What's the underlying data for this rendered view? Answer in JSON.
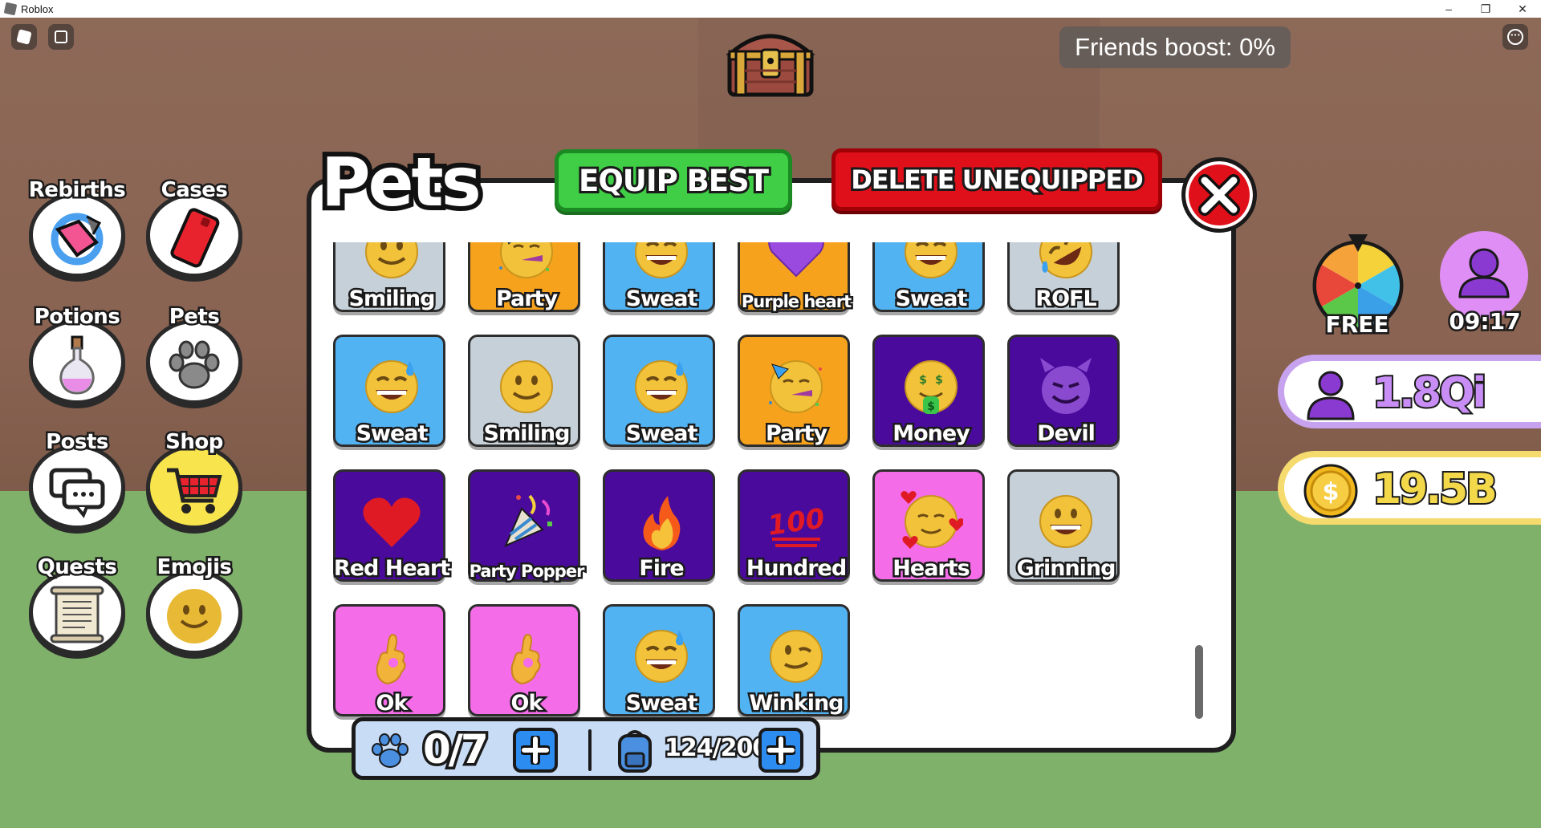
{
  "window": {
    "title": "Roblox",
    "controls": {
      "minimize": "–",
      "maximize": "❐",
      "close": "✕"
    }
  },
  "hud": {
    "friends_boost": "Friends boost: 0%",
    "spin_label": "FREE",
    "timer_label": "09:17",
    "followers_value": "1.8Qi",
    "coins_value": "19.5B"
  },
  "menu": [
    {
      "label": "Rebirths",
      "icon": "rebirth-icon"
    },
    {
      "label": "Cases",
      "icon": "phone-case-icon"
    },
    {
      "label": "Potions",
      "icon": "potion-icon"
    },
    {
      "label": "Pets",
      "icon": "paw-icon"
    },
    {
      "label": "Posts",
      "icon": "chat-icon"
    },
    {
      "label": "Shop",
      "icon": "cart-icon"
    },
    {
      "label": "Quests",
      "icon": "scroll-icon"
    },
    {
      "label": "Emojis",
      "icon": "smiley-icon"
    }
  ],
  "panel": {
    "title": "Pets",
    "equip_best": "EQUIP BEST",
    "delete_unequipped": "DELETE UNEQUIPPED",
    "pets": [
      {
        "name": "Smiling",
        "color": "gray",
        "emoji": "smiling"
      },
      {
        "name": "Party",
        "color": "orange",
        "emoji": "party"
      },
      {
        "name": "Sweat",
        "color": "blue",
        "emoji": "sweat"
      },
      {
        "name": "Purple heart",
        "color": "orange",
        "emoji": "purple-heart"
      },
      {
        "name": "Sweat",
        "color": "blue",
        "emoji": "sweat"
      },
      {
        "name": "ROFL",
        "color": "gray",
        "emoji": "rofl"
      },
      {
        "name": "Sweat",
        "color": "blue",
        "emoji": "sweat"
      },
      {
        "name": "Smiling",
        "color": "gray",
        "emoji": "smiling"
      },
      {
        "name": "Sweat",
        "color": "blue",
        "emoji": "sweat"
      },
      {
        "name": "Party",
        "color": "orange",
        "emoji": "party"
      },
      {
        "name": "Money",
        "color": "purple",
        "emoji": "money"
      },
      {
        "name": "Devil",
        "color": "purple",
        "emoji": "devil"
      },
      {
        "name": "Red Heart",
        "color": "purple",
        "emoji": "red-heart"
      },
      {
        "name": "Party Popper",
        "color": "purple",
        "emoji": "party-popper"
      },
      {
        "name": "Fire",
        "color": "purple",
        "emoji": "fire"
      },
      {
        "name": "Hundred",
        "color": "purple",
        "emoji": "hundred"
      },
      {
        "name": "Hearts",
        "color": "pink",
        "emoji": "hearts"
      },
      {
        "name": "Grinning",
        "color": "gray",
        "emoji": "grinning"
      },
      {
        "name": "Ok",
        "color": "pink",
        "emoji": "ok-hand"
      },
      {
        "name": "Ok",
        "color": "pink",
        "emoji": "ok-hand"
      },
      {
        "name": "Sweat",
        "color": "blue",
        "emoji": "sweat"
      },
      {
        "name": "Winking",
        "color": "blue",
        "emoji": "winking"
      }
    ],
    "equipped_count": "0/7",
    "storage_count": "124/200"
  }
}
